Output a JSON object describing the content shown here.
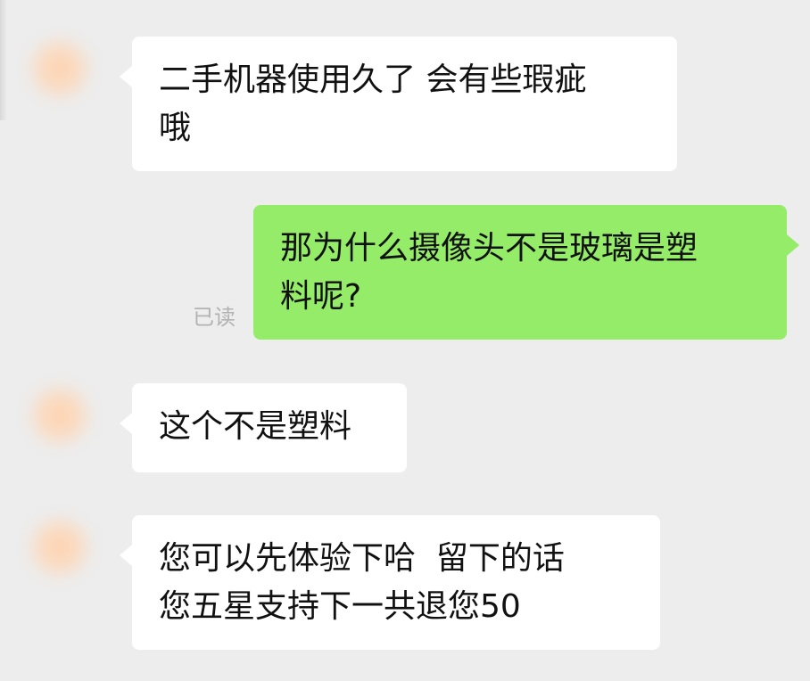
{
  "chat": {
    "messages": [
      {
        "sender": "other",
        "lines": [
          "二手机器使用久了 会有些瑕疵",
          "哦"
        ]
      },
      {
        "sender": "me",
        "lines": [
          "那为什么摄像头不是玻璃是塑",
          "料呢?"
        ],
        "status": "已读"
      },
      {
        "sender": "other",
        "lines": [
          "这个不是塑料"
        ]
      },
      {
        "sender": "other",
        "lines": [
          "您可以先体验下哈  留下的话",
          "您五星支持下一共退您50"
        ]
      }
    ]
  }
}
